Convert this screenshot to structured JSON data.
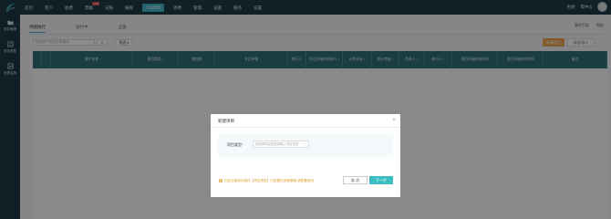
{
  "nav": {
    "items": [
      {
        "label": "首页",
        "active": false
      },
      {
        "label": "客户",
        "active": false
      },
      {
        "label": "收费",
        "active": false
      },
      {
        "label": "票据",
        "active": false,
        "badge": "new"
      },
      {
        "label": "记账",
        "active": false
      },
      {
        "label": "报税",
        "active": false
      },
      {
        "label": "工商项目",
        "active": true
      },
      {
        "label": "消费",
        "active": false
      },
      {
        "label": "管理",
        "active": false
      },
      {
        "label": "设置",
        "active": false
      },
      {
        "label": "服务",
        "active": false
      },
      {
        "label": "设置",
        "active": false
      }
    ],
    "right": {
      "link1": "名厨",
      "link2": "帮中心"
    }
  },
  "sidebar": {
    "items": [
      {
        "label": "项目管理",
        "icon": "folder-icon"
      },
      {
        "label": "项目类型",
        "icon": "list-icon"
      },
      {
        "label": "进度监测",
        "icon": "chart-icon"
      }
    ]
  },
  "tabs": [
    {
      "label": "待我执行",
      "active": true
    },
    {
      "label": "进行中",
      "active": false
    },
    {
      "label": "全部",
      "active": false
    }
  ],
  "right_links": {
    "download": "事件引导",
    "help": "帮助"
  },
  "toolbar": {
    "search_placeholder": "搜索客户/项目名称/编号",
    "search_button": "Q",
    "filter_button": "筛选 ▾",
    "new_button": "新建项目",
    "import_button": "导出/导入"
  },
  "table": {
    "columns": [
      "",
      "",
      "客户名称",
      "项目类型 ↕",
      "流程树",
      "节点环境",
      "执行人",
      "节点开始时间执行 ↕",
      "计划开始 ↕",
      "预计完成 ↕",
      "负责人 ↕",
      "参与人 ↕",
      "项目开始时间时间",
      "项目开始时间时间",
      "备注"
    ]
  },
  "modal": {
    "title": "新建项目",
    "close": "×",
    "field_label": "项目类型",
    "field_required": "*",
    "field_placeholder": "请选择项目类型或输入项目类型",
    "hint": "在此在客制化组件【项目类型】已配置的流程模板,请配置使用",
    "cancel": "取 消",
    "next": "下一步"
  },
  "colors": {
    "accent": "#3bb4c1",
    "topbar": "#1f3b47",
    "header": "#2f6f7b",
    "new_button": "#f0a44f"
  }
}
